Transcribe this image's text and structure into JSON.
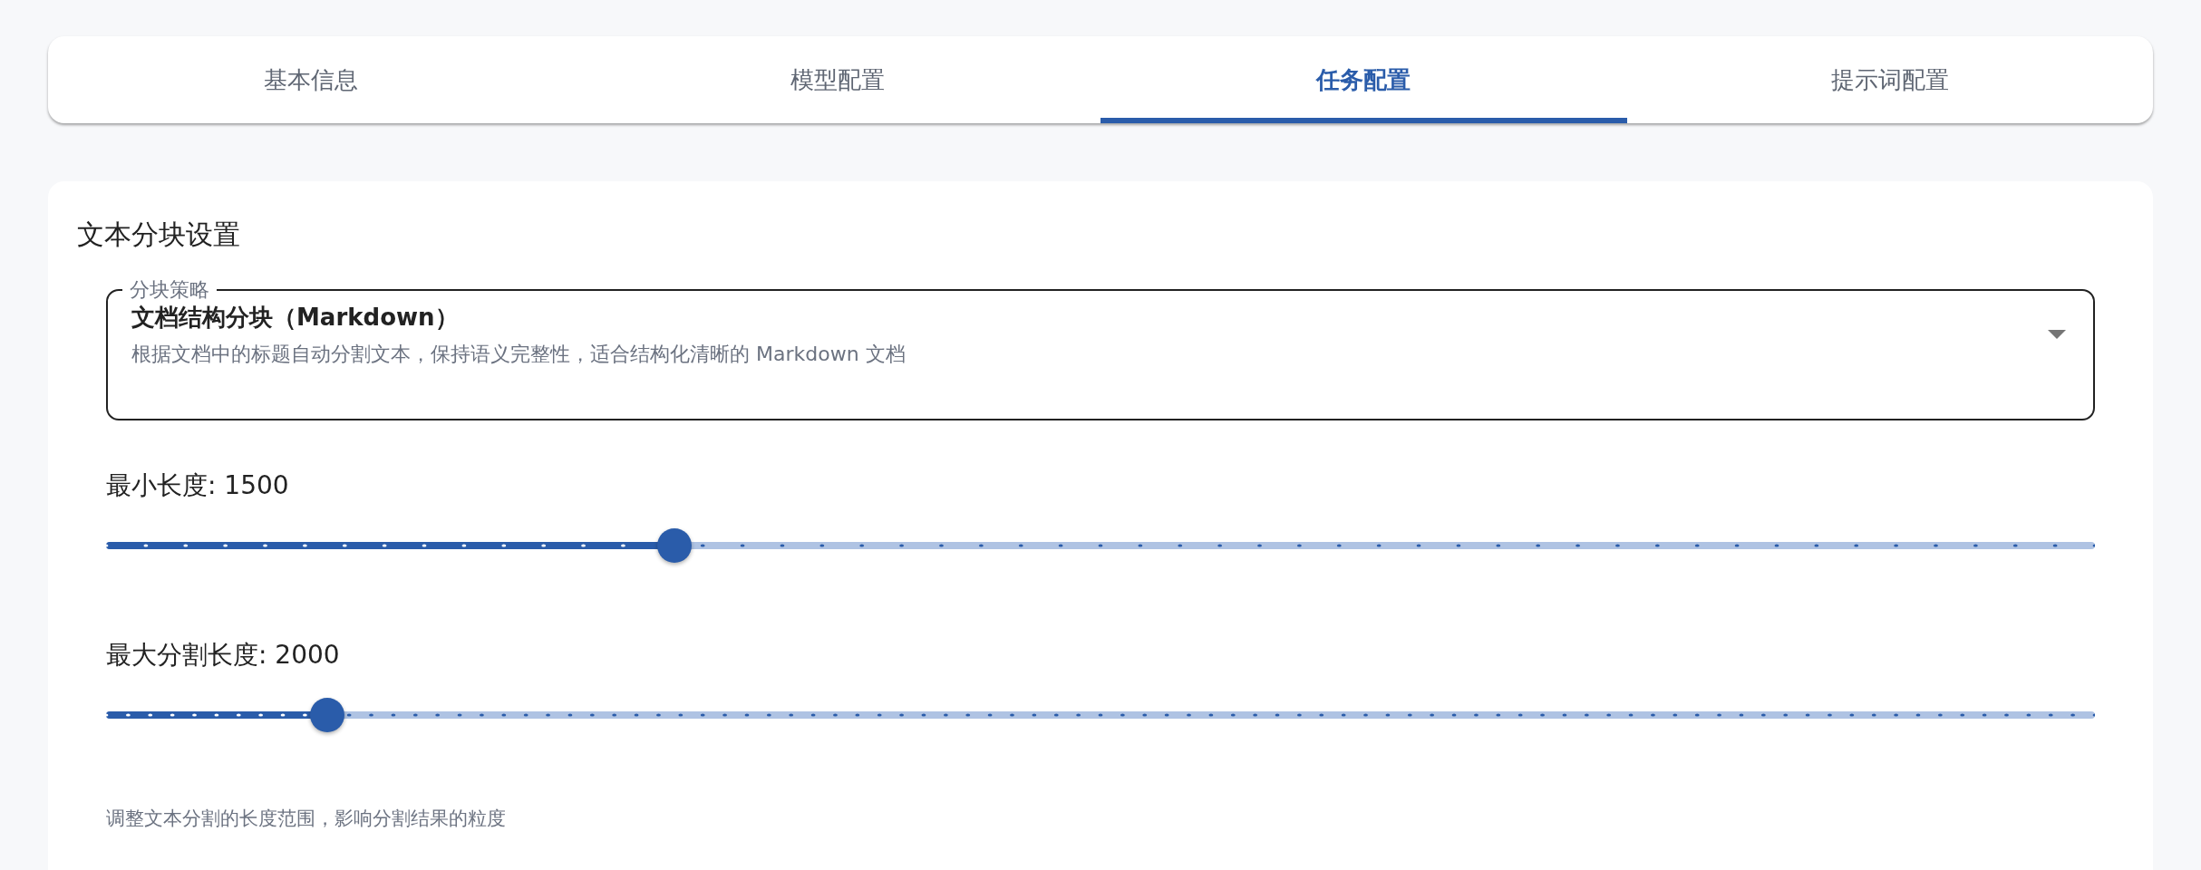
{
  "tabs": [
    {
      "label": "基本信息",
      "selected": false
    },
    {
      "label": "模型配置",
      "selected": false
    },
    {
      "label": "任务配置",
      "selected": true
    },
    {
      "label": "提示词配置",
      "selected": false
    }
  ],
  "section": {
    "title": "文本分块设置",
    "strategy_select": {
      "label": "分块策略",
      "value": "文档结构分块（Markdown）",
      "description": "根据文档中的标题自动分割文本，保持语义完整性，适合结构化清晰的 Markdown 文档"
    },
    "sliders": [
      {
        "label": "最小长度: 1500",
        "level": 0.286
      },
      {
        "label": "最大分割长度: 2000",
        "level": 0.111
      }
    ],
    "help_text": "调整文本分割的长度范围，影响分割结果的粒度"
  }
}
